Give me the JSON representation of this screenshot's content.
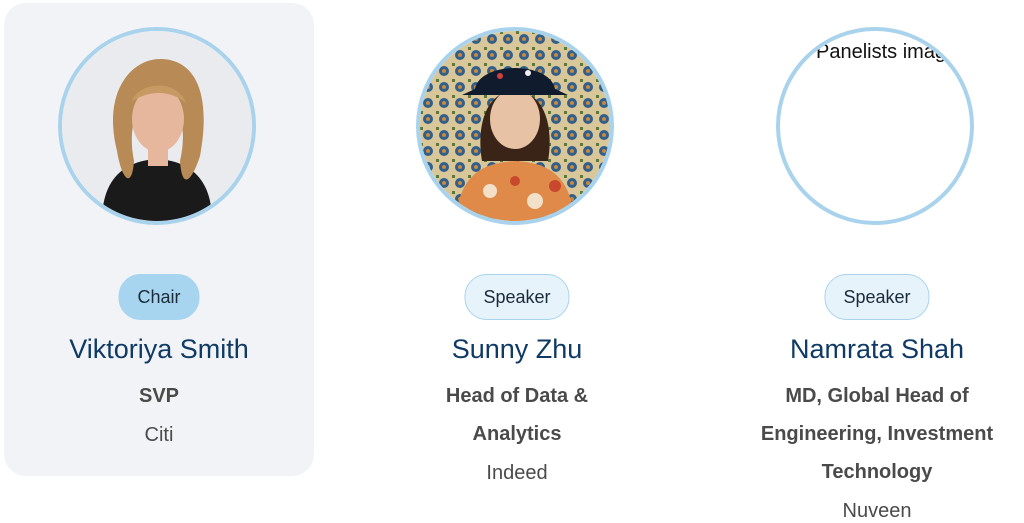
{
  "panelists": [
    {
      "role": "Chair",
      "name": "Viktoriya Smith",
      "title": "SVP",
      "company": "Citi"
    },
    {
      "role": "Speaker",
      "name": "Sunny Zhu",
      "title": "Head of Data & Analytics",
      "company": "Indeed"
    },
    {
      "role": "Speaker",
      "name": "Namrata Shah",
      "title": "MD, Global Head of Engineering, Investment Technology",
      "company": "Nuveen",
      "image_alt": "Panelists image"
    }
  ],
  "colors": {
    "card_background": "#f1f3f6",
    "avatar_ring": "#a9d3ec",
    "chair_badge": "#a7d4ef",
    "speaker_badge": "#e6f3fb",
    "name_text": "#0f3a66",
    "body_text": "#4a4a4a"
  }
}
